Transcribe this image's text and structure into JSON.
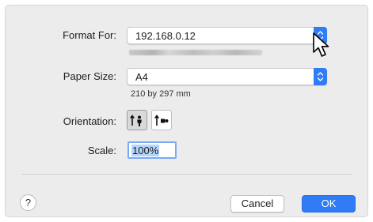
{
  "dialog": {
    "format_for": {
      "label": "Format For:",
      "value": "192.168.0.12"
    },
    "paper_size": {
      "label": "Paper Size:",
      "value": "A4",
      "dimensions": "210 by 297 mm"
    },
    "orientation": {
      "label": "Orientation:",
      "selected": "portrait"
    },
    "scale": {
      "label": "Scale:",
      "value": "100%"
    },
    "buttons": {
      "help": "?",
      "cancel": "Cancel",
      "ok": "OK"
    }
  },
  "colors": {
    "accent": "#2f7cf6",
    "dialog_bg": "#ececec",
    "selection": "#b4d4fd"
  },
  "icons": [
    "chevron-updown-icon",
    "portrait-orientation-icon",
    "landscape-orientation-icon",
    "mouse-pointer-icon"
  ]
}
